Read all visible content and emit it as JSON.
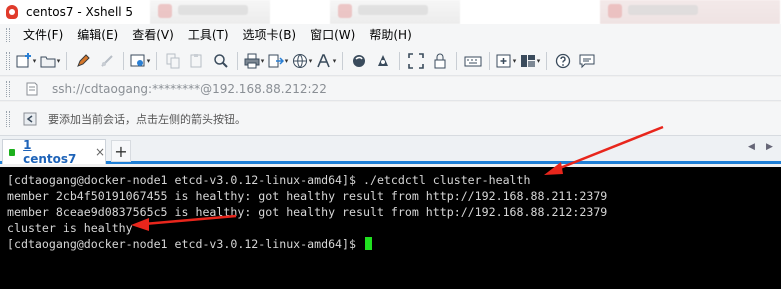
{
  "window": {
    "title": "centos7 - Xshell 5"
  },
  "menu": [
    {
      "label": "文件(F)"
    },
    {
      "label": "编辑(E)"
    },
    {
      "label": "查看(V)"
    },
    {
      "label": "工具(T)"
    },
    {
      "label": "选项卡(B)"
    },
    {
      "label": "窗口(W)"
    },
    {
      "label": "帮助(H)"
    }
  ],
  "toolbar_icons": [
    "new-session-icon",
    "open-folder-icon",
    "pen-icon",
    "disconnect-icon",
    "properties-icon",
    "copy-icon",
    "paste-icon",
    "find-icon",
    "print-icon",
    "transfer-icon",
    "globe-icon",
    "font-icon",
    "xftp-icon",
    "xagent-icon",
    "fullscreen-icon",
    "lock-icon",
    "keyboard-icon",
    "new-tab-icon",
    "layout-icon",
    "help-icon",
    "chat-icon"
  ],
  "address": {
    "text": "ssh://cdtaogang:********@192.168.88.212:22"
  },
  "hint": {
    "text": "要添加当前会话，点击左侧的箭头按钮。"
  },
  "tabs": [
    {
      "number": "1",
      "name": "centos7",
      "status_color": "#1db01d",
      "active": true
    }
  ],
  "tab_close": "×",
  "tab_add": "+",
  "terminal": {
    "lines": [
      "[cdtaogang@docker-node1 etcd-v3.0.12-linux-amd64]$ ./etcdctl cluster-health",
      "member 2cb4f50191067455 is healthy: got healthy result from http://192.168.88.211:2379",
      "member 8ceae9d0837565c5 is healthy: got healthy result from http://192.168.88.212:2379",
      "cluster is healthy",
      "[cdtaogang@docker-node1 etcd-v3.0.12-linux-amd64]$ "
    ],
    "cursor_color": "#20e020",
    "background": "#000000",
    "foreground": "#d6d6d6"
  },
  "annotation_color": "#e8261c"
}
